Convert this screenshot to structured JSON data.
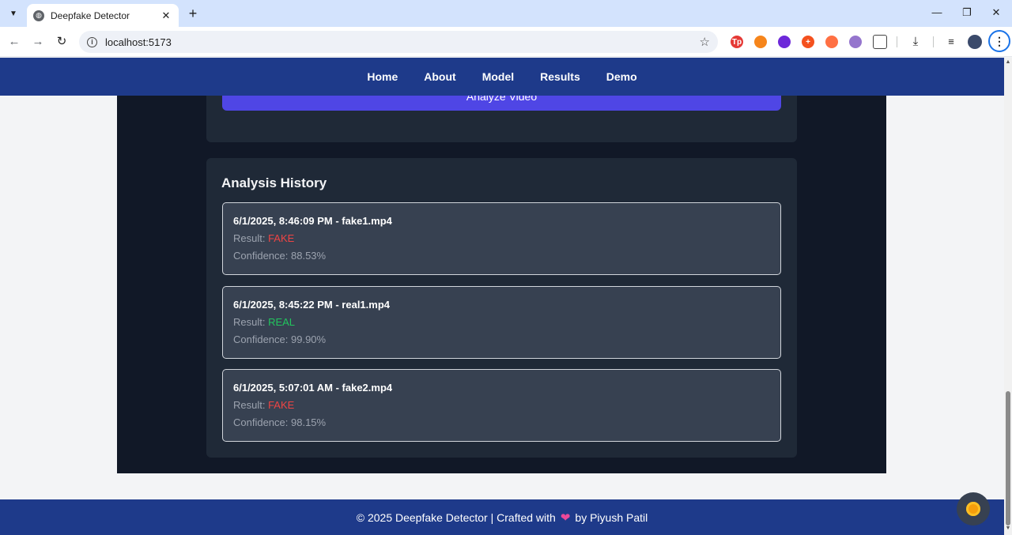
{
  "browser": {
    "tab_title": "Deepfake Detector",
    "url": "localhost:5173",
    "extensions": [
      {
        "name": "tp-extension-icon",
        "label": "Tp",
        "color": "#e53935"
      },
      {
        "name": "metamask-icon",
        "label": "",
        "color": "#f6851b"
      },
      {
        "name": "circle-extension-icon",
        "label": "",
        "color": "#6d28d9"
      },
      {
        "name": "plus-extension-icon",
        "label": "+",
        "color": "#f4511e"
      },
      {
        "name": "flame-extension-icon",
        "label": "",
        "color": "#ff7043"
      },
      {
        "name": "ghost-extension-icon",
        "label": "",
        "color": "#9575cd"
      }
    ]
  },
  "navbar": {
    "links": [
      "Home",
      "About",
      "Model",
      "Results",
      "Demo"
    ]
  },
  "analyze": {
    "button_label": "Analyze Video"
  },
  "history": {
    "title": "Analysis History",
    "result_label": "Result: ",
    "items": [
      {
        "title": "6/1/2025, 8:46:09 PM - fake1.mp4",
        "result": "FAKE",
        "confidence": "Confidence: 88.53%"
      },
      {
        "title": "6/1/2025, 8:45:22 PM - real1.mp4",
        "result": "REAL",
        "confidence": "Confidence: 99.90%"
      },
      {
        "title": "6/1/2025, 5:07:01 AM - fake2.mp4",
        "result": "FAKE",
        "confidence": "Confidence: 98.15%"
      }
    ]
  },
  "footer": {
    "left_text": "© 2025 Deepfake Detector | Crafted with",
    "heart": "❤",
    "right_text": "by Piyush Patil"
  },
  "colors": {
    "navbar": "#1e3a8a",
    "button": "#4f46e5",
    "fake": "#ef4444",
    "real": "#22c55e"
  }
}
